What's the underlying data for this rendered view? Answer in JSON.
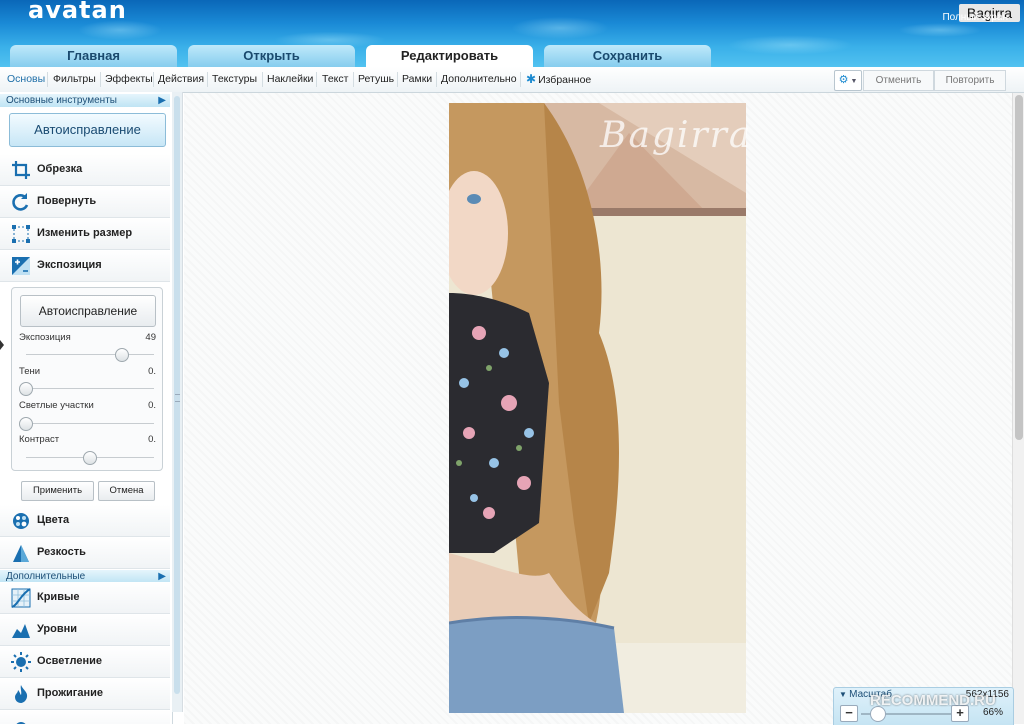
{
  "app": {
    "logo": "avatan",
    "window_title": "Bagirra",
    "fullscreen": "Полный экран"
  },
  "tabs": [
    {
      "label": "Главная"
    },
    {
      "label": "Открыть"
    },
    {
      "label": "Редактировать",
      "active": true
    },
    {
      "label": "Сохранить"
    }
  ],
  "toolbar": {
    "items": [
      "Основы",
      "Фильтры",
      "Эффекты",
      "Действия",
      "Текстуры",
      "Наклейки",
      "Текст",
      "Ретушь",
      "Рамки",
      "Дополнительно"
    ],
    "favorites": "Избранное",
    "gear_icon": "gear-icon",
    "undo": "Отменить",
    "redo": "Повторить"
  },
  "left_panel": {
    "basic_header": "Основные инструменты",
    "auto_fix": "Автоисправление",
    "tools": [
      {
        "label": "Обрезка",
        "icon": "crop-icon"
      },
      {
        "label": "Повернуть",
        "icon": "rotate-icon"
      },
      {
        "label": "Изменить размер",
        "icon": "resize-icon"
      },
      {
        "label": "Экспозиция",
        "icon": "exposure-icon"
      }
    ],
    "exposure": {
      "auto_fix": "Автоисправление",
      "sliders": [
        {
          "label": "Экспозиция",
          "value": "49",
          "level": 0.75
        },
        {
          "label": "Тени",
          "value": "0.",
          "level": 0.0
        },
        {
          "label": "Светлые участки",
          "value": "0.",
          "level": 0.0
        },
        {
          "label": "Контраст",
          "value": "0.",
          "level": 0.5
        }
      ],
      "apply": "Применить",
      "cancel": "Отмена"
    },
    "tools2": [
      {
        "label": "Цвета",
        "icon": "colors-icon"
      },
      {
        "label": "Резкость",
        "icon": "sharpness-icon"
      }
    ],
    "extra_header": "Дополнительные",
    "tools3": [
      {
        "label": "Кривые",
        "icon": "curves-icon"
      },
      {
        "label": "Уровни",
        "icon": "levels-icon"
      },
      {
        "label": "Осветление",
        "icon": "dodge-icon"
      },
      {
        "label": "Прожигание",
        "icon": "burn-icon"
      }
    ]
  },
  "canvas": {
    "watermark": "Bagirra"
  },
  "zoom": {
    "label": "Масштаб",
    "size": "562x1156",
    "percent": "66%",
    "level": 0.1
  },
  "overlay": {
    "watermark": "RECOMMEND.RU"
  },
  "colors": {
    "accent": "#1c8ad0",
    "header_dark": "#0a67b8",
    "header_light": "#52c2f0"
  }
}
